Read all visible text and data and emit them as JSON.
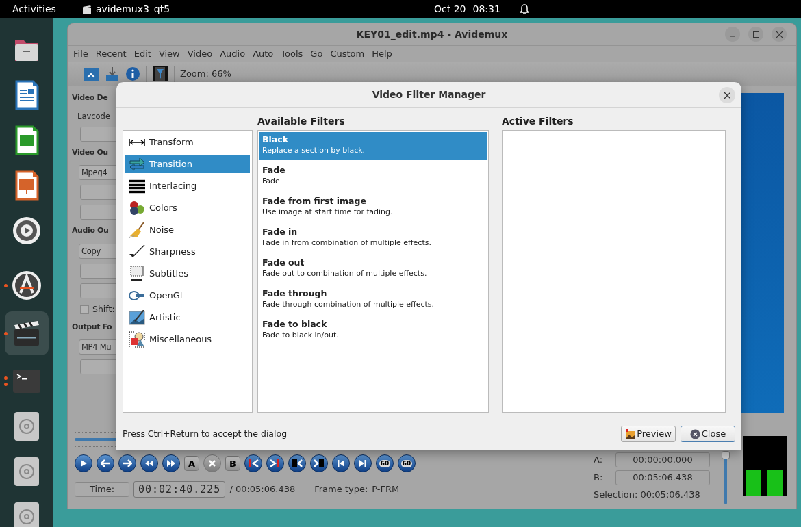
{
  "top_bar": {
    "activities": "Activities",
    "app_name": "avidemux3_qt5",
    "date": "Oct 20",
    "time": "08:31"
  },
  "dock": [
    {
      "kind": "files",
      "running": false,
      "selected": false
    },
    {
      "kind": "writer",
      "running": false,
      "selected": false
    },
    {
      "kind": "calc",
      "running": false,
      "selected": false
    },
    {
      "kind": "impress",
      "running": false,
      "selected": false
    },
    {
      "kind": "gear",
      "running": false,
      "selected": false
    },
    {
      "kind": "separator"
    },
    {
      "kind": "updater",
      "running": true,
      "multiple_windows": false,
      "selected": false
    },
    {
      "kind": "clapper",
      "running": true,
      "multiple_windows": false,
      "selected": true
    },
    {
      "kind": "terminal",
      "running": true,
      "multiple_windows": true,
      "selected": false
    },
    {
      "kind": "disc",
      "running": false,
      "selected": false
    },
    {
      "kind": "disc",
      "running": false,
      "selected": false
    },
    {
      "kind": "disc",
      "running": false,
      "selected": false
    }
  ],
  "window": {
    "title": "KEY01_edit.mp4 - Avidemux",
    "menu": [
      "File",
      "Recent",
      "Edit",
      "View",
      "Video",
      "Audio",
      "Auto",
      "Tools",
      "Go",
      "Custom",
      "Help"
    ],
    "zoom": "Zoom: 66%",
    "left_panel": [
      {
        "title": "Video De",
        "items": [
          {
            "kind": "label",
            "text": "Lavcode"
          },
          {
            "kind": "button"
          }
        ]
      },
      {
        "title": "Video Ou",
        "items": [
          {
            "kind": "combo",
            "text": "Mpeg4"
          },
          {
            "kind": "button"
          },
          {
            "kind": "button"
          }
        ]
      },
      {
        "title": "Audio Ou",
        "items": [
          {
            "kind": "combo",
            "text": "Copy"
          },
          {
            "kind": "button"
          },
          {
            "kind": "button"
          },
          {
            "kind": "checkbox",
            "text": "Shift:",
            "checked": false
          }
        ]
      },
      {
        "title": "Output Fo",
        "items": [
          {
            "kind": "combo",
            "text": "MP4 Mu"
          },
          {
            "kind": "button"
          }
        ]
      }
    ],
    "controls": [
      {
        "kind": "play"
      },
      {
        "kind": "prev"
      },
      {
        "kind": "next"
      },
      {
        "kind": "rewind"
      },
      {
        "kind": "forward"
      },
      {
        "kind": "mark",
        "label": "A"
      },
      {
        "kind": "reset"
      },
      {
        "kind": "mark",
        "label": "B"
      },
      {
        "kind": "prev-cut"
      },
      {
        "kind": "next-cut"
      },
      {
        "kind": "prev-key"
      },
      {
        "kind": "next-key"
      },
      {
        "kind": "first"
      },
      {
        "kind": "last"
      },
      {
        "kind": "jump",
        "label": "60"
      },
      {
        "kind": "jump",
        "label": "60"
      }
    ],
    "time_button": "Time:",
    "current_time": "00:02:40.225",
    "duration": "/ 00:05:06.438",
    "frame_type_label": "Frame type:",
    "frame_type": "P-FRM",
    "marker_a_label": "A:",
    "marker_a": "00:00:00.000",
    "marker_b_label": "B:",
    "marker_b": "00:05:06.438",
    "selection": "Selection: 00:05:06.438",
    "timeline": {
      "level": 0.52
    },
    "volume": {
      "level": 1
    }
  },
  "dialog": {
    "title": "Video Filter Manager",
    "categories": [
      {
        "label": "Transform",
        "kind": "transform",
        "selected": false
      },
      {
        "label": "Transition",
        "kind": "transition",
        "selected": true
      },
      {
        "label": "Interlacing",
        "kind": "interlacing",
        "selected": false
      },
      {
        "label": "Colors",
        "kind": "colors",
        "selected": false
      },
      {
        "label": "Noise",
        "kind": "noise",
        "selected": false
      },
      {
        "label": "Sharpness",
        "kind": "sharpness",
        "selected": false
      },
      {
        "label": "Subtitles",
        "kind": "subtitles",
        "selected": false
      },
      {
        "label": "OpenGl",
        "kind": "opengl",
        "selected": false
      },
      {
        "label": "Artistic",
        "kind": "artistic",
        "selected": false
      },
      {
        "label": "Miscellaneous",
        "kind": "misc",
        "selected": false
      }
    ],
    "available_title": "Available Filters",
    "available": [
      {
        "name": "Black",
        "description": "Replace a section by black.",
        "selected": true
      },
      {
        "name": "Fade",
        "description": "Fade.",
        "selected": false
      },
      {
        "name": "Fade from first image",
        "description": "Use image at start time for fading.",
        "selected": false
      },
      {
        "name": "Fade in",
        "description": "Fade in from combination of multiple effects.",
        "selected": false
      },
      {
        "name": "Fade out",
        "description": "Fade out to combination of multiple effects.",
        "selected": false
      },
      {
        "name": "Fade through",
        "description": "Fade through combination of multiple effects.",
        "selected": false
      },
      {
        "name": "Fade to black",
        "description": "Fade to black in/out.",
        "selected": false
      }
    ],
    "active_title": "Active Filters",
    "hint": "Press Ctrl+Return to accept the dialog",
    "buttons": [
      {
        "kind": "preview",
        "label": "Preview"
      },
      {
        "kind": "close",
        "label": "Close"
      }
    ]
  }
}
